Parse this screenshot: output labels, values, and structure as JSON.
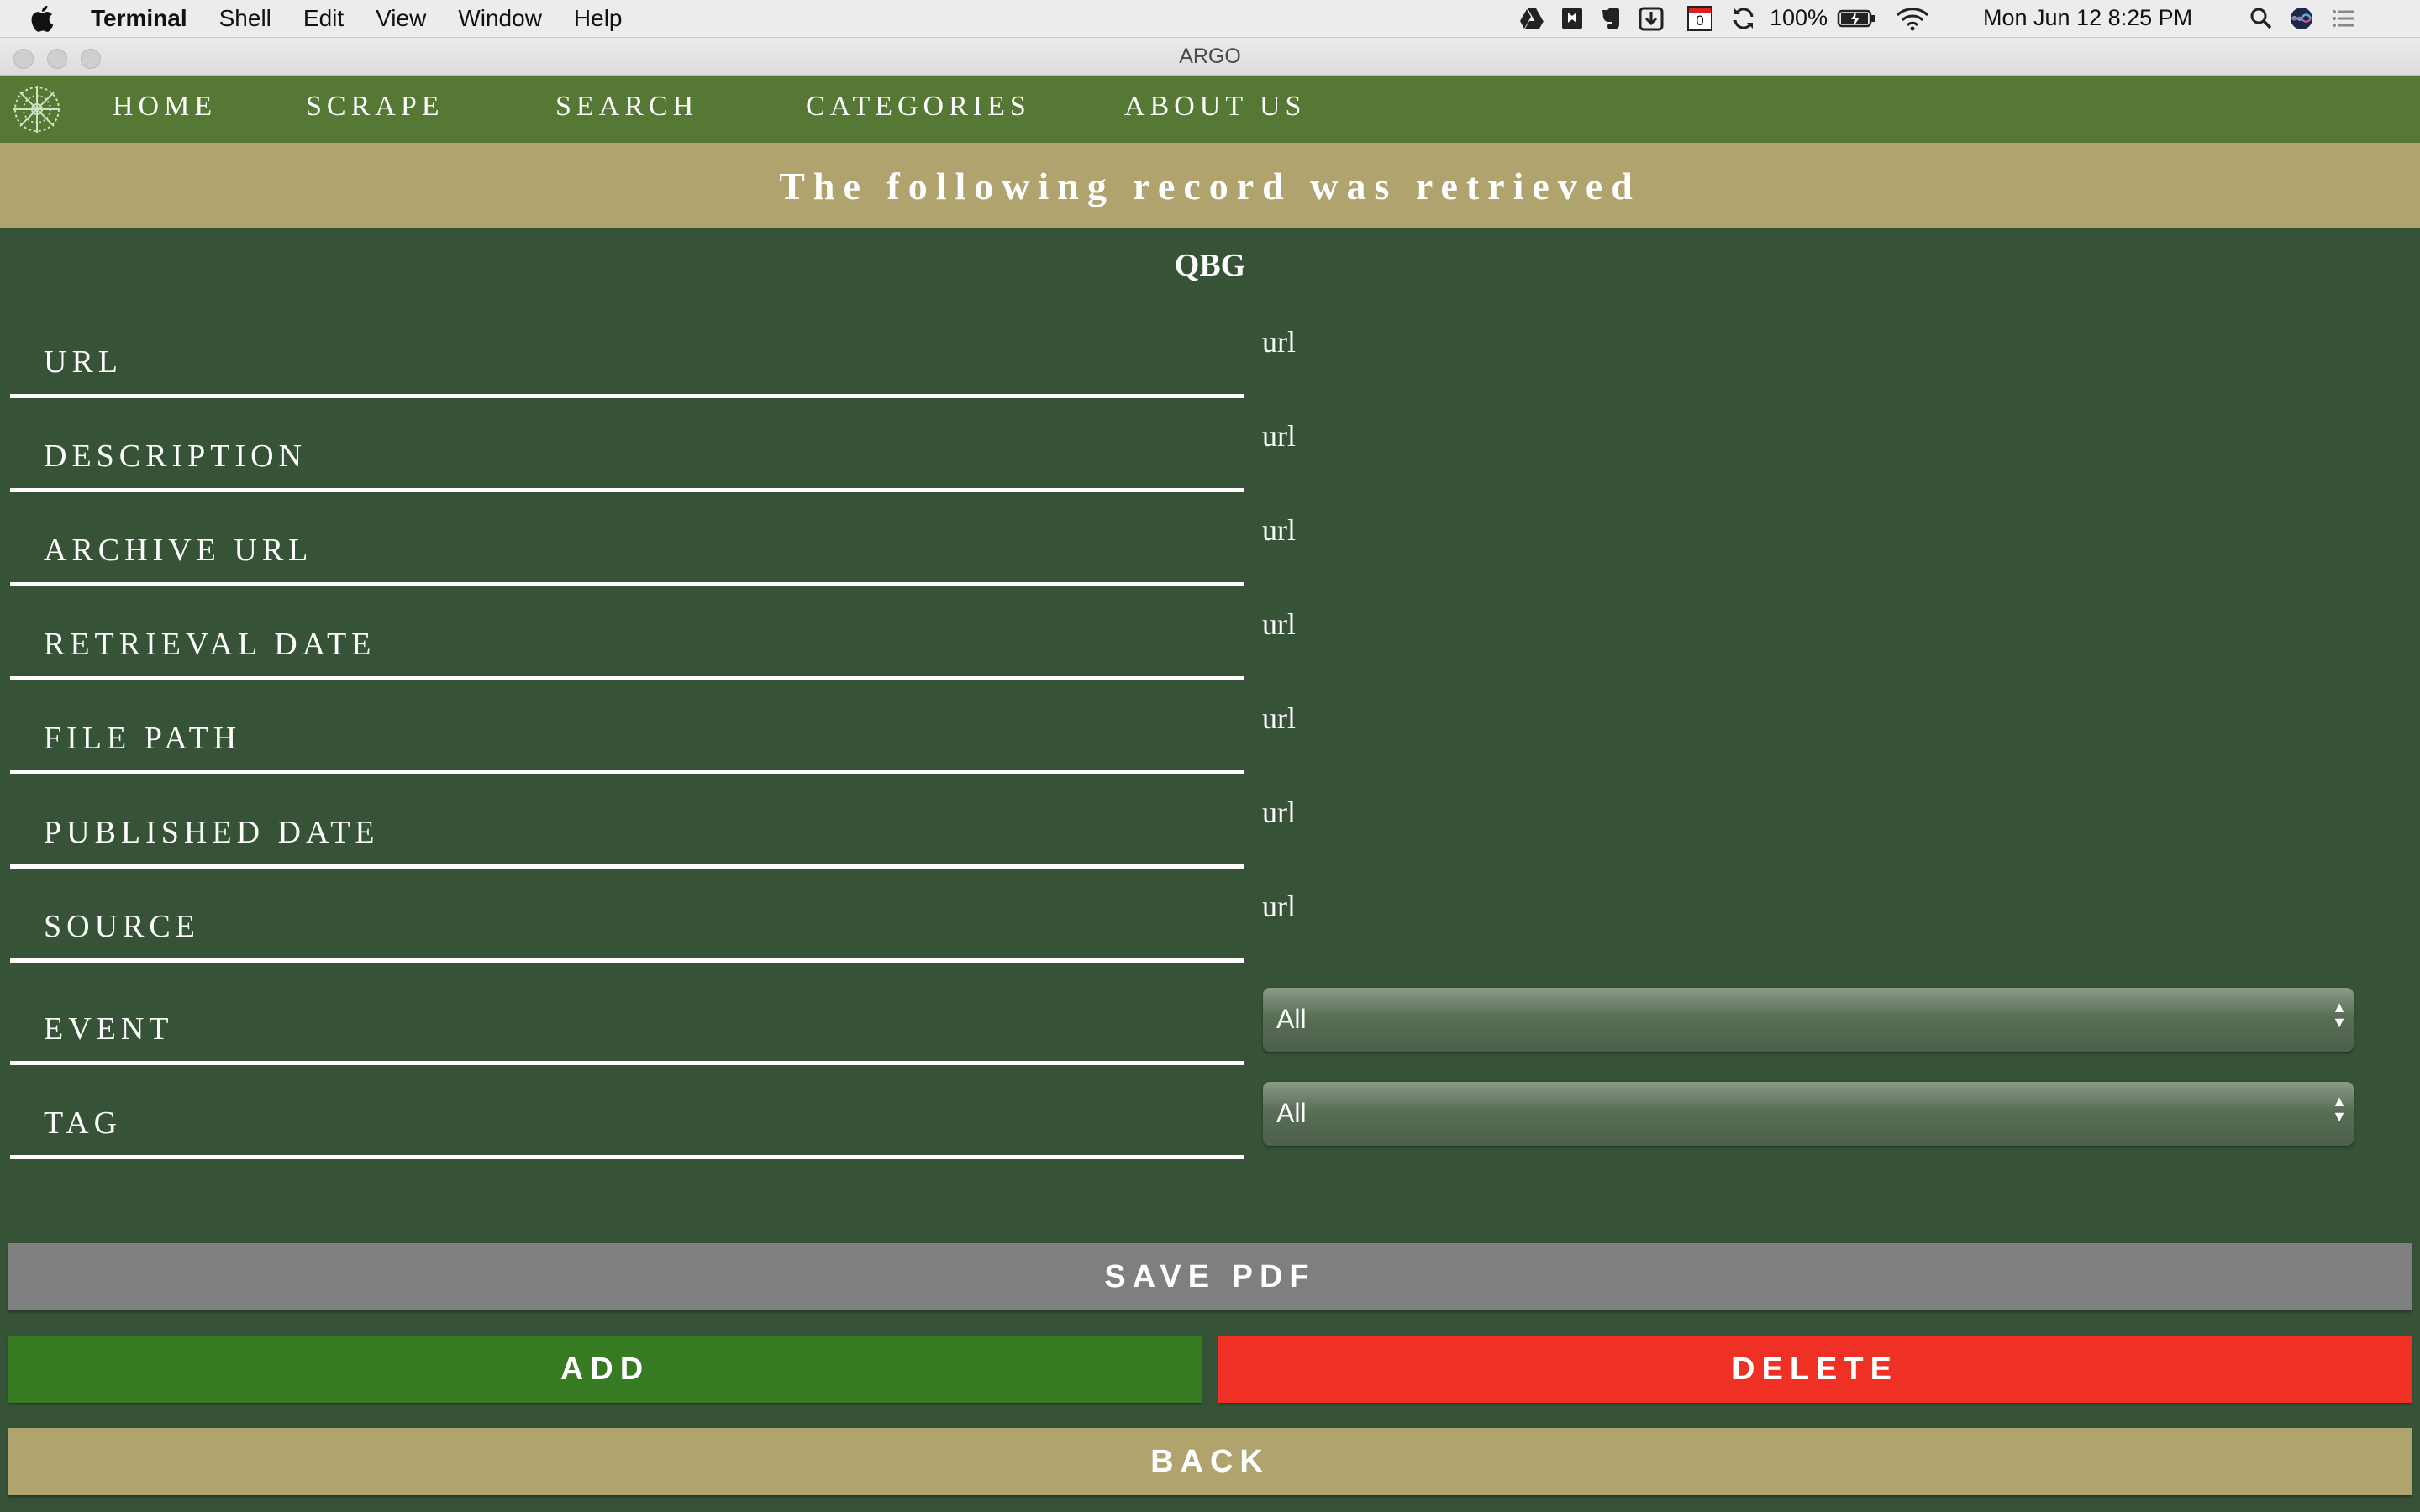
{
  "menubar": {
    "app_name": "Terminal",
    "items": [
      "Shell",
      "Edit",
      "View",
      "Window",
      "Help"
    ],
    "battery": "100%",
    "datetime": "Mon Jun 12  8:25 PM",
    "calendar_badge": "0",
    "status_icons": [
      "google-drive-icon",
      "bookmark-icon",
      "evernote-icon",
      "download-icon",
      "calendar-icon",
      "sync-icon",
      "battery-icon",
      "wifi-icon",
      "search-icon",
      "siri-icon",
      "notification-center-icon"
    ]
  },
  "window": {
    "title": "ARGO"
  },
  "nav": {
    "items": [
      "HOME",
      "SCRAPE",
      "SEARCH",
      "CATEGORIES",
      "ABOUT US"
    ]
  },
  "banner": {
    "text": "The following record was retrieved"
  },
  "record": {
    "name": "QBG",
    "fields": [
      {
        "label": "URL",
        "value": "url"
      },
      {
        "label": "DESCRIPTION",
        "value": "url"
      },
      {
        "label": "ARCHIVE URL",
        "value": "url"
      },
      {
        "label": "RETRIEVAL DATE",
        "value": "url"
      },
      {
        "label": "FILE PATH",
        "value": "url"
      },
      {
        "label": "PUBLISHED DATE",
        "value": "url"
      },
      {
        "label": "SOURCE",
        "value": "url"
      }
    ],
    "event": {
      "label": "EVENT",
      "selected": "All"
    },
    "tag": {
      "label": "TAG",
      "selected": "All"
    }
  },
  "buttons": {
    "save_pdf": "SAVE PDF",
    "add": "ADD",
    "delete": "DELETE",
    "back": "BACK"
  },
  "colors": {
    "background": "#365337",
    "nav": "#557834",
    "banner": "#b0a36e",
    "save_pdf": "#7f7f7f",
    "add": "#367b21",
    "delete": "#ee3124",
    "back": "#b0a36e"
  }
}
